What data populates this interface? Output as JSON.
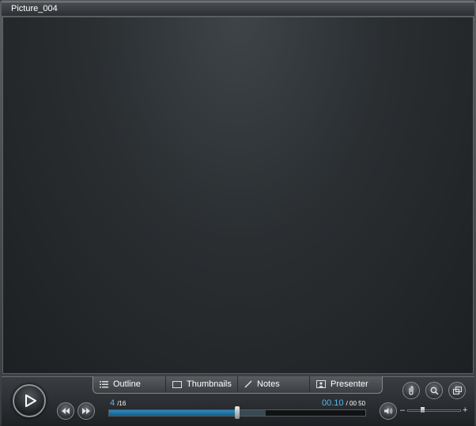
{
  "window": {
    "title": "Picture_004"
  },
  "tabs": [
    {
      "label": "Outline",
      "icon": "outline-icon"
    },
    {
      "label": "Thumbnails",
      "icon": "thumbnails-icon"
    },
    {
      "label": "Notes",
      "icon": "notes-pencil-icon"
    },
    {
      "label": "Presenter",
      "icon": "presenter-icon"
    }
  ],
  "playback": {
    "current_slide": "4",
    "total_slides": "/16",
    "current_time": "00.10",
    "total_time": "/ 00 50",
    "progress_fraction": 0.5,
    "buffered_fraction": 0.61
  },
  "volume": {
    "minus": "–",
    "plus": "+",
    "level_fraction": 0.28
  },
  "colors": {
    "accent": "#56b6e8",
    "background": "#2a2d30"
  }
}
